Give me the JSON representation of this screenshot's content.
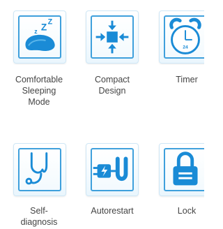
{
  "features": [
    {
      "label": "Comfortable\nSleeping\nMode",
      "icon": "sleep-pillow-icon"
    },
    {
      "label": "Compact\nDesign",
      "icon": "compact-arrows-icon"
    },
    {
      "label": "Timer",
      "icon": "alarm-clock-icon",
      "clock_text": "24"
    },
    {
      "label": "Self-\ndiagnosis",
      "icon": "stethoscope-icon"
    },
    {
      "label": "Autorestart",
      "icon": "plug-restart-icon"
    },
    {
      "label": "Lock",
      "icon": "padlock-icon"
    }
  ],
  "colors": {
    "accent": "#1a8bd6",
    "border": "#3fa0dc",
    "text": "#444444"
  }
}
